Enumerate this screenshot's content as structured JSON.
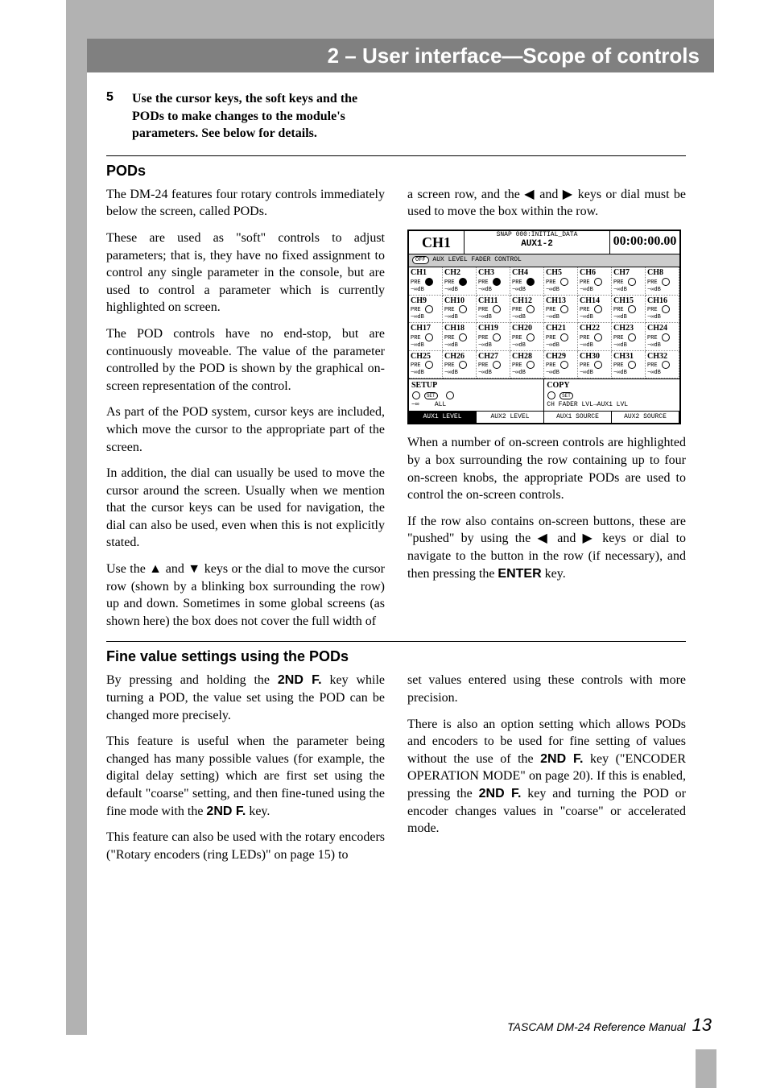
{
  "header": "2 – User interface—Scope of controls",
  "step": {
    "num": "5",
    "text": "Use the cursor keys, the soft keys and the PODs to make changes to the module's parameters. See below for details."
  },
  "pods": {
    "heading": "PODs",
    "p1": "The DM-24 features four rotary controls immediately below the screen, called PODs.",
    "p2": "These are used as \"soft\" controls to adjust parameters; that is, they have no fixed assignment to control any single parameter in the console, but are used to control a parameter which is currently highlighted on screen.",
    "p3": "The POD controls have no end-stop, but are continuously moveable. The value of the parameter controlled by the POD is shown by the graphical on-screen representation of the control.",
    "p4": "As part of the POD system, cursor keys are included, which move the cursor to the appropriate part of the screen.",
    "p5": "In addition, the dial can usually be used to move the cursor around the screen. Usually when we mention that the cursor keys can be used for navigation, the dial can also be used, even when this is not explicitly stated.",
    "p6a": "Use the ",
    "p6b": " and ",
    "p6c": " keys or the dial to move the cursor row (shown by a blinking box surrounding the row) up and down. Sometimes in some global screens (as shown here) the box does not cover the full width of ",
    "p7a": "a screen row, and the ",
    "p7b": " and ",
    "p7c": " keys or dial must be used to move the box within the row.",
    "p8": "When a number of on-screen controls are highlighted by a box surrounding the row containing up to four on-screen knobs, the appropriate PODs are used to control the on-screen controls.",
    "p9a": "If the row also contains on-screen buttons, these are \"pushed\" by using the ",
    "p9b": " and ",
    "p9c": " keys or dial to navigate to the button in the row (if necessary), and then pressing the ",
    "p9d": "ENTER",
    "p9e": " key."
  },
  "fine": {
    "heading": "Fine value settings using the PODs",
    "p1a": "By pressing and holding the ",
    "p1b": "2ND F.",
    "p1c": " key while turning a POD, the value set using the POD can be changed more precisely.",
    "p2a": "This feature is useful when the parameter being changed has many possible values (for example, the digital delay setting) which are first set using the default \"coarse\" setting, and then fine-tuned using the fine mode with the ",
    "p2b": "2ND F.",
    "p2c": " key.",
    "p3": "This feature can also be used with the rotary encoders (\"Rotary encoders (ring LEDs)\" on page 15) to ",
    "p4": "set values entered using these controls with more precision.",
    "p5a": "There is also an option setting which allows PODs and encoders to be used for fine setting of values without the use of the ",
    "p5b": "2ND F.",
    "p5c": " key (\"ENCODER OPERATION MODE\" on page 20). If this is enabled, pressing the ",
    "p5d": "2ND F.",
    "p5e": " key and turning the POD or encoder changes values in \"coarse\" or accelerated mode."
  },
  "screenshot": {
    "ch": "CH1",
    "topline": "SNAP 000:INITIAL_DATA",
    "aux": "AUX1-2",
    "time": "00:00:00.00",
    "sub": "AUX LEVEL FADER CONTROL",
    "channels": [
      {
        "n": "CH1",
        "filled": true
      },
      {
        "n": "CH2",
        "filled": true
      },
      {
        "n": "CH3",
        "filled": true
      },
      {
        "n": "CH4",
        "filled": true
      },
      {
        "n": "CH5",
        "filled": false
      },
      {
        "n": "CH6",
        "filled": false
      },
      {
        "n": "CH7",
        "filled": false
      },
      {
        "n": "CH8",
        "filled": false
      },
      {
        "n": "CH9",
        "filled": false
      },
      {
        "n": "CH10",
        "filled": false
      },
      {
        "n": "CH11",
        "filled": false
      },
      {
        "n": "CH12",
        "filled": false
      },
      {
        "n": "CH13",
        "filled": false
      },
      {
        "n": "CH14",
        "filled": false
      },
      {
        "n": "CH15",
        "filled": false
      },
      {
        "n": "CH16",
        "filled": false
      },
      {
        "n": "CH17",
        "filled": false
      },
      {
        "n": "CH18",
        "filled": false
      },
      {
        "n": "CH19",
        "filled": false
      },
      {
        "n": "CH20",
        "filled": false
      },
      {
        "n": "CH21",
        "filled": false
      },
      {
        "n": "CH22",
        "filled": false
      },
      {
        "n": "CH23",
        "filled": false
      },
      {
        "n": "CH24",
        "filled": false
      },
      {
        "n": "CH25",
        "filled": false
      },
      {
        "n": "CH26",
        "filled": false
      },
      {
        "n": "CH27",
        "filled": false
      },
      {
        "n": "CH28",
        "filled": false
      },
      {
        "n": "CH29",
        "filled": false
      },
      {
        "n": "CH30",
        "filled": false
      },
      {
        "n": "CH31",
        "filled": false
      },
      {
        "n": "CH32",
        "filled": false
      }
    ],
    "pre": "PRE",
    "db": "−∞dB",
    "setup": {
      "label": "SETUP",
      "set": "SET",
      "inf": "−∞",
      "all": "ALL"
    },
    "copy": {
      "label": "COPY",
      "set": "SET",
      "text": "CH FADER LVL→AUX1 LVL"
    },
    "tabs": [
      "AUX1 LEVEL",
      "AUX2 LEVEL",
      "AUX1 SOURCE",
      "AUX2 SOURCE"
    ]
  },
  "footer": {
    "text": "TASCAM DM-24 Reference Manual",
    "page": "13"
  },
  "glyphs": {
    "up": "▲",
    "down": "▼",
    "left": "◀",
    "right": "▶"
  }
}
